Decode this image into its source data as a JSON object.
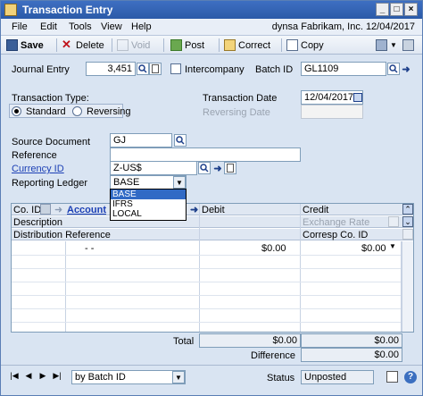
{
  "window": {
    "title": "Transaction Entry"
  },
  "menu": {
    "items": [
      "File",
      "Edit",
      "Tools",
      "View",
      "Help"
    ],
    "company": "dynsa  Fabrikam, Inc.",
    "date": "12/04/2017"
  },
  "toolbar": {
    "save": "Save",
    "delete": "Delete",
    "void": "Void",
    "post": "Post",
    "correct": "Correct",
    "copy": "Copy"
  },
  "header": {
    "journal_entry_label": "Journal Entry",
    "journal_entry_value": "3,451",
    "intercompany_label": "Intercompany",
    "batch_id_label": "Batch ID",
    "batch_id_value": "GL1109",
    "transaction_type_label": "Transaction Type:",
    "standard_label": "Standard",
    "reversing_label": "Reversing",
    "transaction_date_label": "Transaction Date",
    "transaction_date_value": "12/04/2017",
    "reversing_date_label": "Reversing Date",
    "source_document_label": "Source Document",
    "source_document_value": "GJ",
    "reference_label": "Reference",
    "reference_value": "",
    "currency_id_label": "Currency ID",
    "currency_id_value": "Z-US$",
    "reporting_ledger_label": "Reporting Ledger",
    "reporting_ledger_value": "BASE"
  },
  "ledger_options": [
    "BASE",
    "IFRS",
    "LOCAL"
  ],
  "grid": {
    "co_id": "Co. ID",
    "account": "Account",
    "debit": "Debit",
    "credit": "Credit",
    "description": "Description",
    "exchange_rate": "Exchange Rate",
    "distribution_reference": "Distribution Reference",
    "corresp_co_id": "Corresp Co. ID",
    "row1": {
      "account": "-     -",
      "debit": "$0.00",
      "credit": "$0.00"
    }
  },
  "totals": {
    "total_label": "Total",
    "total_debit": "$0.00",
    "total_credit": "$0.00",
    "difference_label": "Difference",
    "difference_value": "$0.00"
  },
  "footer": {
    "sort_value": "by Batch ID",
    "status_label": "Status",
    "status_value": "Unposted"
  }
}
